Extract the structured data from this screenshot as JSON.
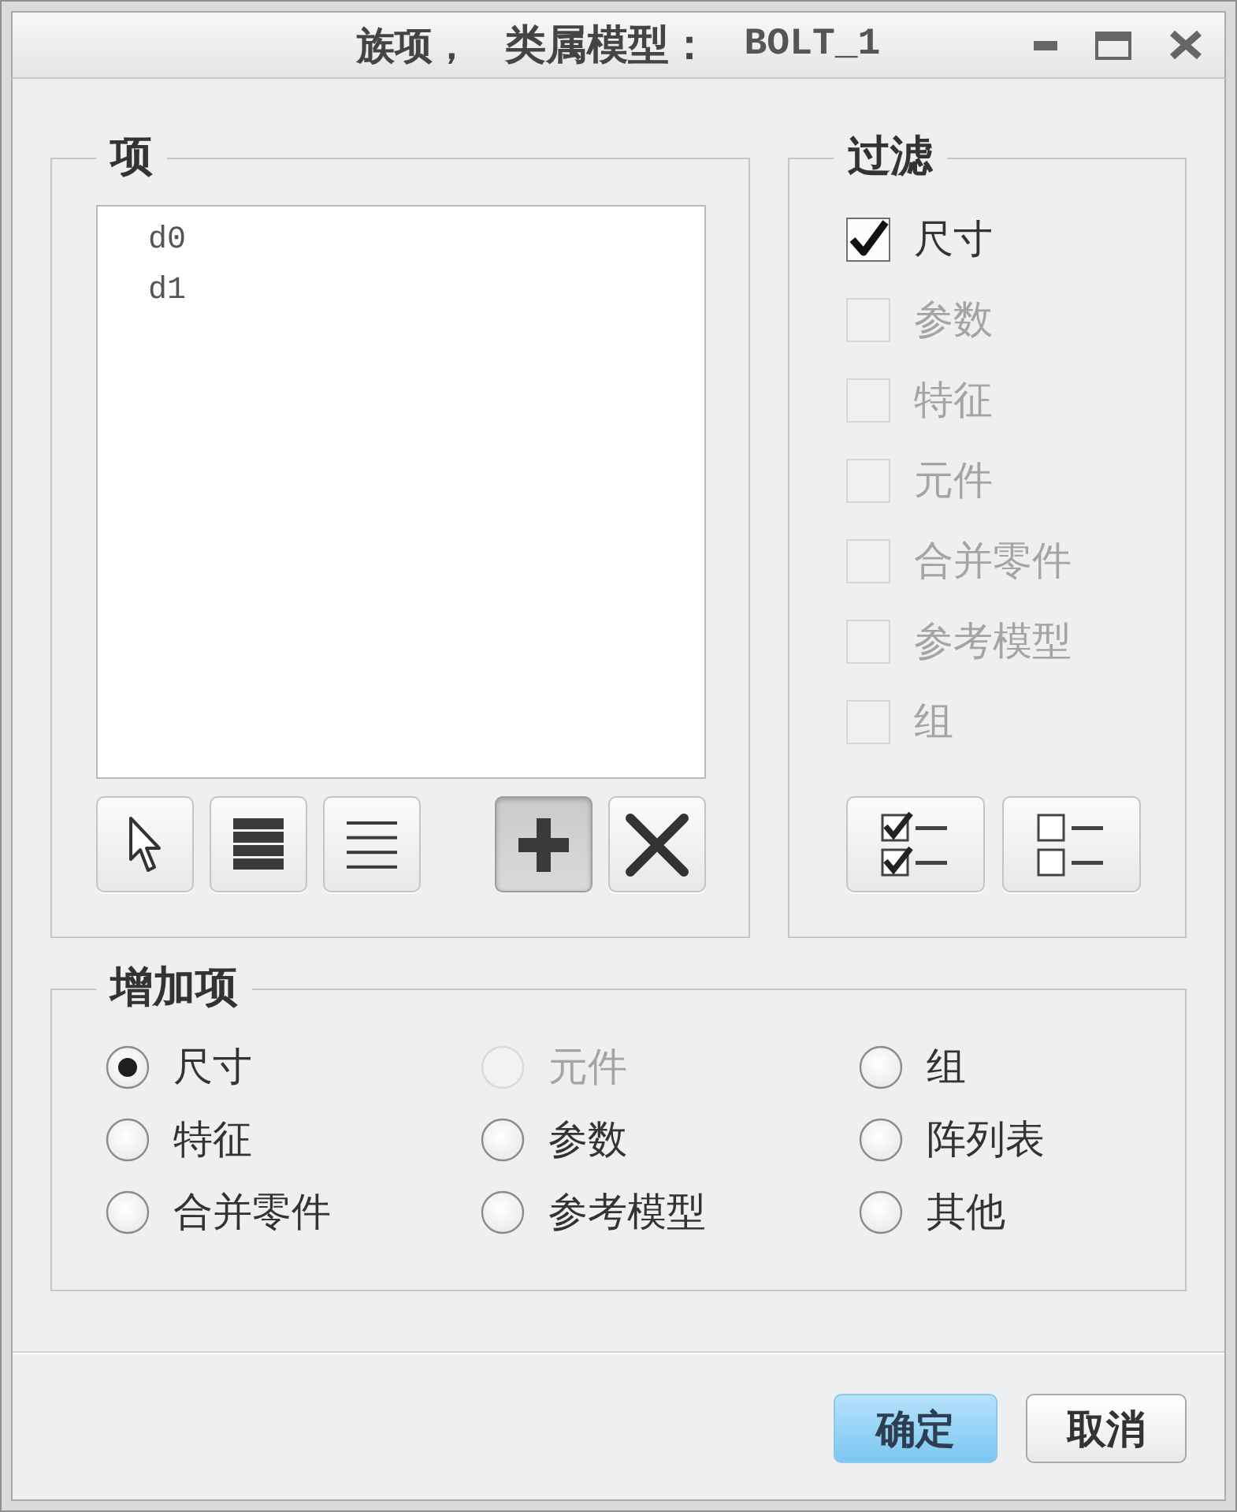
{
  "window": {
    "title": "族项，",
    "label": "类属模型：",
    "model": "BOLT_1"
  },
  "items": {
    "legend": "项",
    "list": [
      {
        "text": "d0",
        "selected": false
      },
      {
        "text": "d1",
        "selected": false
      }
    ],
    "tools": [
      {
        "kind": "pick",
        "pressed": false
      },
      {
        "kind": "select_all",
        "pressed": false
      },
      {
        "kind": "deselect_all",
        "pressed": false
      }
    ],
    "edit_tools": [
      {
        "kind": "add",
        "pressed": true
      },
      {
        "kind": "remove",
        "pressed": false
      }
    ]
  },
  "filter": {
    "legend": "过滤",
    "options": [
      {
        "label": "尺寸",
        "checked": true,
        "disabled": false
      },
      {
        "label": "参数",
        "checked": false,
        "disabled": true
      },
      {
        "label": "特征",
        "checked": false,
        "disabled": true
      },
      {
        "label": "元件",
        "checked": false,
        "disabled": true
      },
      {
        "label": "合并零件",
        "checked": false,
        "disabled": true
      },
      {
        "label": "参考模型",
        "checked": false,
        "disabled": true
      },
      {
        "label": "组",
        "checked": false,
        "disabled": true
      }
    ],
    "tools": [
      {
        "kind": "check_all"
      },
      {
        "kind": "uncheck_all"
      }
    ]
  },
  "add_items": {
    "legend": "增加项",
    "options": [
      {
        "label": "尺寸",
        "selected": true,
        "disabled": false
      },
      {
        "label": "元件",
        "selected": false,
        "disabled": true
      },
      {
        "label": "组",
        "selected": false,
        "disabled": false
      },
      {
        "label": "特征",
        "selected": false,
        "disabled": false
      },
      {
        "label": "参数",
        "selected": false,
        "disabled": false
      },
      {
        "label": "阵列表",
        "selected": false,
        "disabled": false
      },
      {
        "label": "合并零件",
        "selected": false,
        "disabled": false
      },
      {
        "label": "参考模型",
        "selected": false,
        "disabled": false
      },
      {
        "label": "其他",
        "selected": false,
        "disabled": false
      }
    ]
  },
  "footer": {
    "buttons": [
      {
        "label": "确定",
        "default": true
      },
      {
        "label": "取消",
        "default": false
      }
    ]
  }
}
